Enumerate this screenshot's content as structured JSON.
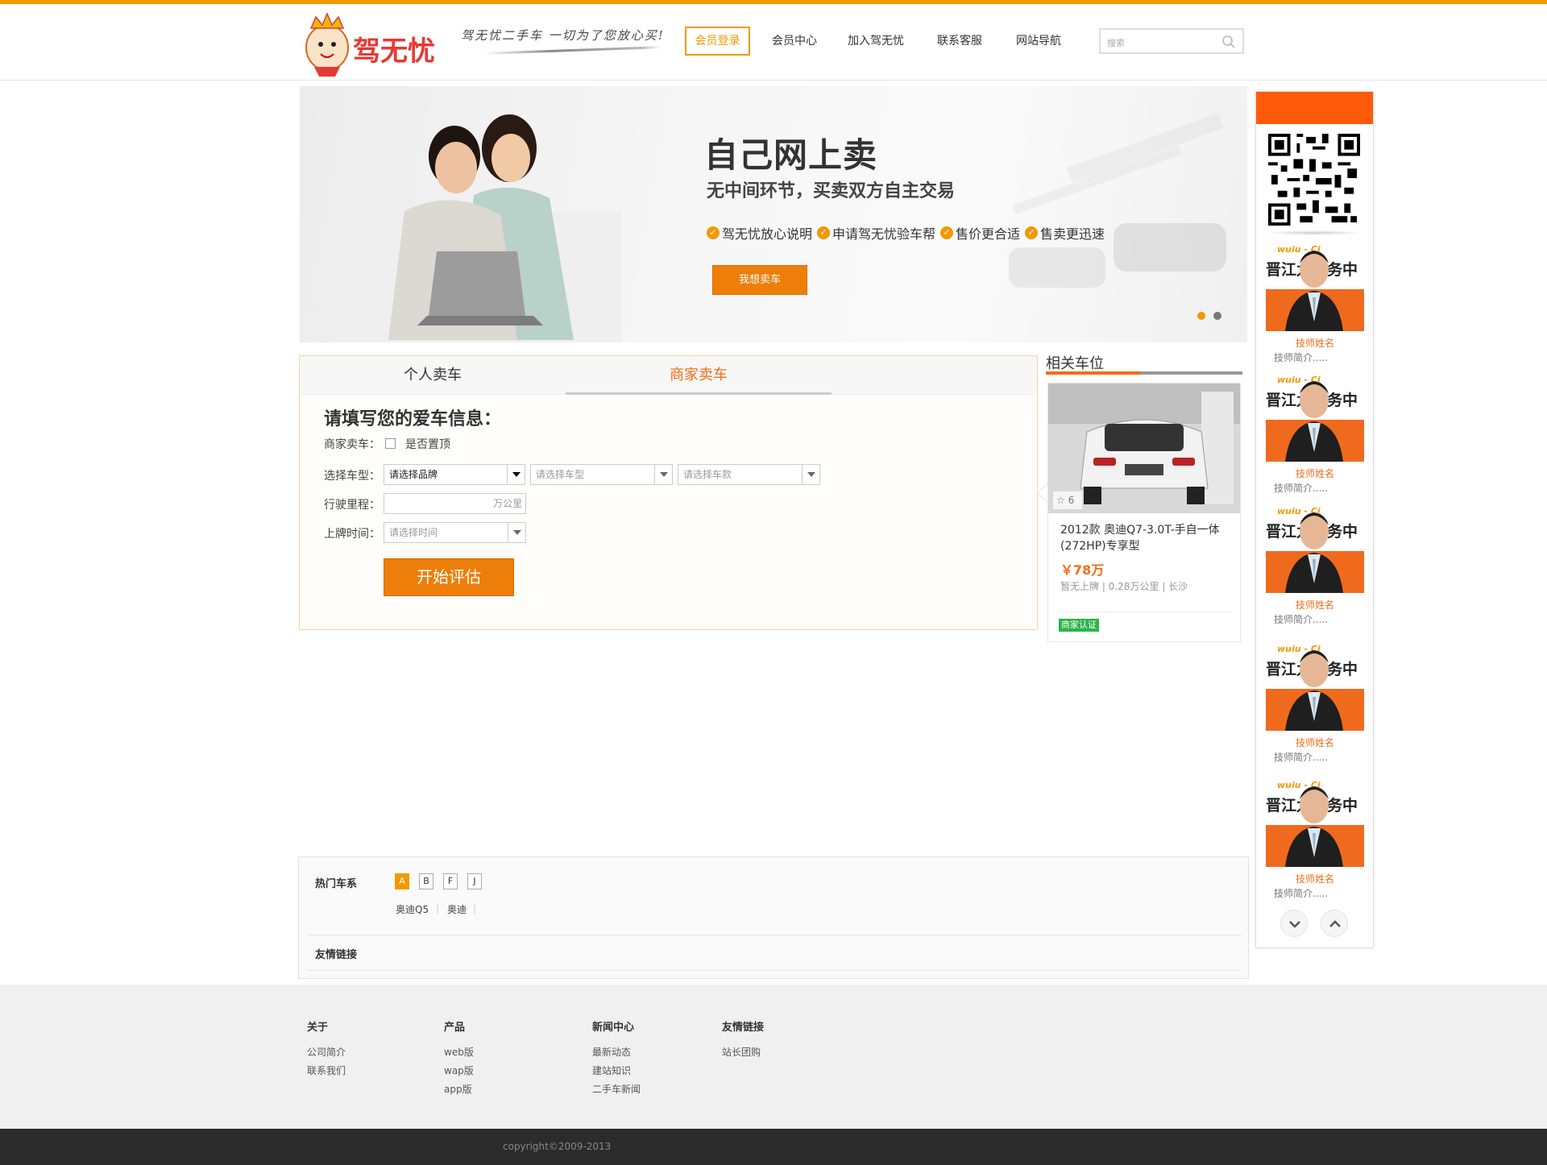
{
  "brand": {
    "name": "驾无忧",
    "slogan": "驾无忧二手车 一切为了您放心买!"
  },
  "nav": {
    "items": [
      {
        "label": "会员登录",
        "active": true
      },
      {
        "label": "会员中心"
      },
      {
        "label": "加入驾无忧"
      },
      {
        "label": "联系客服"
      },
      {
        "label": "网站导航"
      }
    ],
    "search_placeholder": "搜索"
  },
  "banner": {
    "title": "自己网上卖",
    "subtitle": "无中间环节，买卖双方自主交易",
    "points": [
      "驾无忧放心说明",
      "申请驾无忧验车帮",
      "售价更合适",
      "售卖更迅速"
    ],
    "button": "我想卖车",
    "active_dot": 0
  },
  "sell": {
    "tabs": [
      {
        "label": "个人卖车"
      },
      {
        "label": "商家卖车",
        "active": true
      }
    ],
    "form_title": "请填写您的爱车信息：",
    "merchant_label": "商家卖车：",
    "pin_label": "是否置顶",
    "model_label": "选择车型：",
    "brand_select": "请选择品牌",
    "type_select": "请选择车型",
    "style_select": "请选择车款",
    "mileage_label": "行驶里程：",
    "mileage_unit": "万公里",
    "plate_label": "上牌时间：",
    "plate_select": "请选择时间",
    "submit": "开始评估"
  },
  "related": {
    "title": "相关车位",
    "car": {
      "favorites": "6",
      "title": "2012款 奥迪Q7-3.0T-手自一体(272HP)专享型",
      "price": "￥78万",
      "meta": "暂无上牌 | 0.28万公里 | 长沙",
      "badge": "商家认证"
    }
  },
  "sidebar": {
    "techs": [
      {
        "name": "技师姓名",
        "intro": "技师简介....."
      },
      {
        "name": "技师姓名",
        "intro": "技师简介....."
      },
      {
        "name": "技师姓名",
        "intro": "技师简介....."
      },
      {
        "name": "技师姓名",
        "intro": "技师简介....."
      },
      {
        "name": "技师姓名",
        "intro": "技师简介....."
      }
    ],
    "photo_sign": "晋江九服务中",
    "photo_sign_top": "wuiu - Ci"
  },
  "hot": {
    "label": "热门车系",
    "letters": [
      {
        "label": "A",
        "active": true
      },
      {
        "label": "B"
      },
      {
        "label": "F"
      },
      {
        "label": "J"
      }
    ],
    "series": [
      "奥迪Q5",
      "奥迪"
    ],
    "links_label": "友情链接"
  },
  "footer": {
    "columns": [
      {
        "title": "关于",
        "links": [
          "公司简介",
          "联系我们"
        ]
      },
      {
        "title": "产品",
        "links": [
          "web版",
          "wap版",
          "app版"
        ]
      },
      {
        "title": "新闻中心",
        "links": [
          "最新动态",
          "建站知识",
          "二手车新闻"
        ]
      },
      {
        "title": "友情链接",
        "links": [
          "站长团购"
        ]
      }
    ],
    "copyright": "copyright©2009-2013"
  },
  "colors": {
    "accent": "#f39800",
    "orange": "#f56c1a",
    "badge_green": "#2cb34a"
  }
}
